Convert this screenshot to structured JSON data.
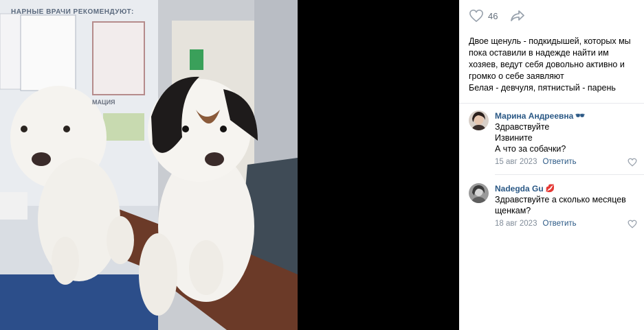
{
  "photo": {
    "sign_text": "НАРНЫЕ ВРАЧИ РЕКОМЕНДУЮТ:",
    "sign2_text": "МАЦИЯ"
  },
  "actions": {
    "likes_count": "46"
  },
  "post": {
    "caption_line1": "Двое щенуль - подкидышей, которых мы пока оставили в надежде найти им хозяев, ведут себя довольно активно и громко о себе заявляют",
    "caption_line2": "Белая - девчуля, пятнистый - парень"
  },
  "comments": [
    {
      "author": "Марина Андреевна",
      "emoji": "🕶",
      "lines": [
        "Здравствуйте",
        "Извините",
        "А что за собачки?"
      ],
      "date": "15 авг 2023",
      "reply_label": "Ответить"
    },
    {
      "author": "Nadegda Gu",
      "emoji": "💋",
      "lines": [
        "Здравствуйте а сколько месяцев щенкам?"
      ],
      "date": "18 авг 2023",
      "reply_label": "Ответить"
    }
  ],
  "colors": {
    "link": "#2a5885",
    "meta": "#818c99",
    "icon": "#99a2ad"
  }
}
